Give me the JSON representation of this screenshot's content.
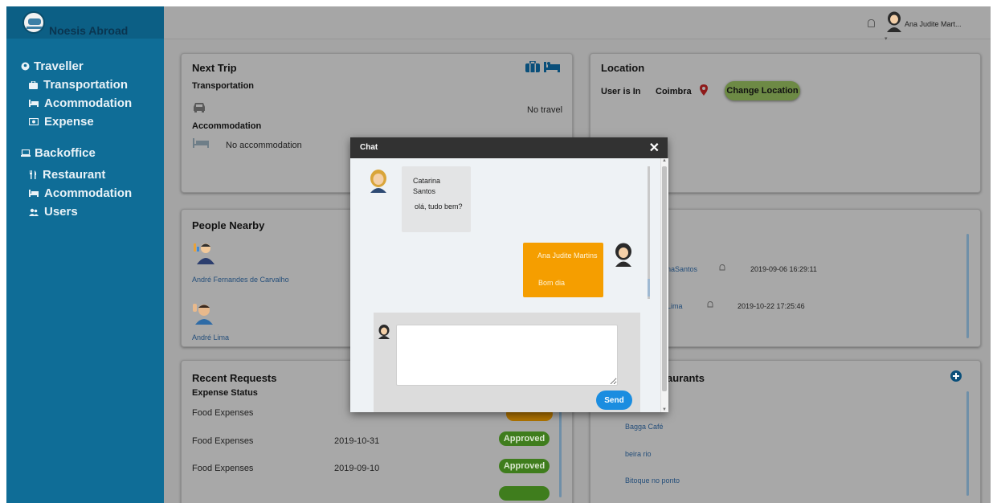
{
  "brand": {
    "name": "Noesis Abroad"
  },
  "header": {
    "user_name": "Ana Judite Mart...",
    "notification_icon": "bell-icon"
  },
  "sidebar": {
    "sections": [
      {
        "label": "Traveller",
        "icon": "map-marker-icon",
        "items": [
          {
            "label": "Transportation",
            "icon": "briefcase-icon"
          },
          {
            "label": "Acommodation",
            "icon": "bed-icon"
          },
          {
            "label": "Expense",
            "icon": "money-icon"
          }
        ]
      },
      {
        "label": "Backoffice",
        "icon": "laptop-icon",
        "items": [
          {
            "label": "Restaurant",
            "icon": "utensils-icon"
          },
          {
            "label": "Acommodation",
            "icon": "bed-icon"
          },
          {
            "label": "Users",
            "icon": "users-icon"
          }
        ]
      }
    ]
  },
  "next_trip": {
    "title": "Next Trip",
    "transportation_label": "Transportation",
    "no_travel": "No travel",
    "accommodation_label": "Accommodation",
    "no_accommodation": "No accommodation"
  },
  "location": {
    "title": "Location",
    "user_is_in": "User is In",
    "city": "Coimbra",
    "change_button": "Change Location"
  },
  "people_nearby": {
    "title": "People Nearby",
    "people": [
      {
        "name": "André Fernandes de Carvalho"
      },
      {
        "name": "André Lima"
      }
    ]
  },
  "messages": {
    "rows": [
      {
        "name_fragment": "naSantos",
        "datetime": "2019-09-06 16:29:11"
      },
      {
        "name_fragment": "Lima",
        "datetime": "2019-10-22 17:25:46"
      }
    ]
  },
  "recent_requests": {
    "title": "Recent Requests",
    "expense_status_label": "Expense Status",
    "rows": [
      {
        "type": "Food Expenses",
        "date": "",
        "status": ""
      },
      {
        "type": "Food Expenses",
        "date": "2019-10-31",
        "status": "Approved"
      },
      {
        "type": "Food Expenses",
        "date": "2019-09-10",
        "status": "Approved"
      }
    ]
  },
  "restaurants": {
    "title_fragment": "aurants",
    "items": [
      "Bagga Café",
      "beira rio",
      "Bitoque no ponto"
    ]
  },
  "chat": {
    "title": "Chat",
    "messages": [
      {
        "sender": "Catarina Santos",
        "text": "olá, tudo bem?",
        "direction": "in"
      },
      {
        "sender": "Ana Judite Martins",
        "text": "Bom dia",
        "direction": "out"
      }
    ],
    "input_value": "",
    "send_label": "Send"
  },
  "colors": {
    "sidebar": "#0f6d97",
    "approved": "#3f7d1d",
    "outgoing_bubble": "#f59e00",
    "send_button": "#1b8de0",
    "modal_header": "#323232"
  }
}
